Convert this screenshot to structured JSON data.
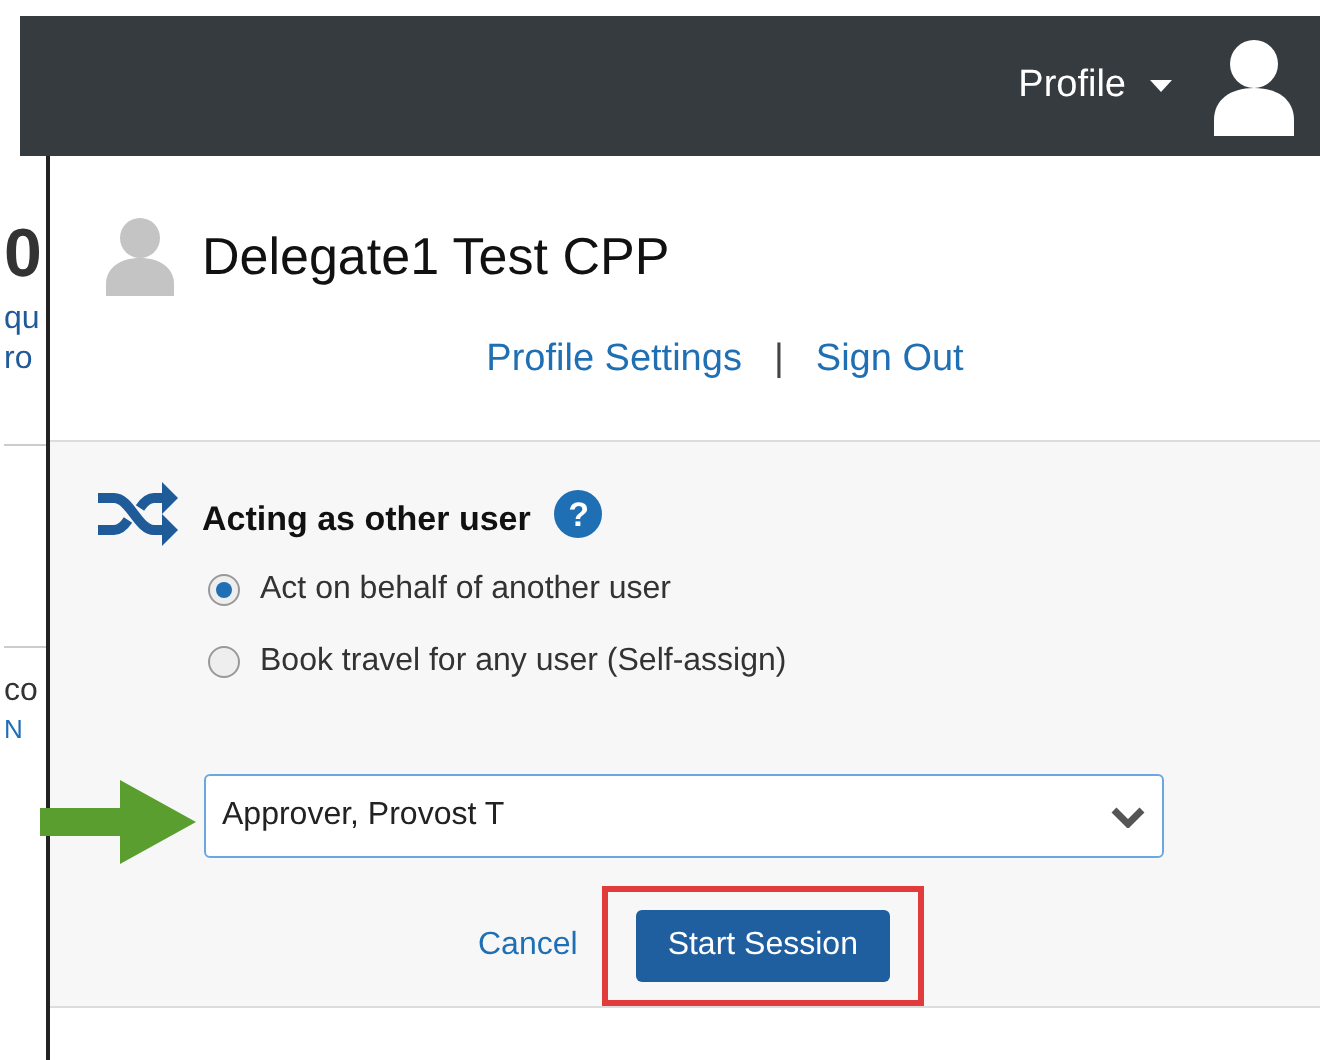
{
  "top_bar": {
    "profile_menu": "Profile"
  },
  "background_fragments": [
    "0",
    "qu",
    "ro",
    "co",
    "N"
  ],
  "profile_panel": {
    "user_name": "Delegate1 Test CPP",
    "links": [
      "Profile Settings",
      "Sign Out"
    ],
    "separator": "|",
    "acting_section": {
      "title": "Acting as other user",
      "help": "?",
      "options": [
        {
          "label": "Act on behalf of another user",
          "selected": true
        },
        {
          "label": "Book travel for any user (Self-assign)",
          "selected": false
        }
      ],
      "user_field": {
        "value": "Approver, Provost T"
      },
      "cancel": "Cancel",
      "start_session": "Start Session"
    }
  }
}
